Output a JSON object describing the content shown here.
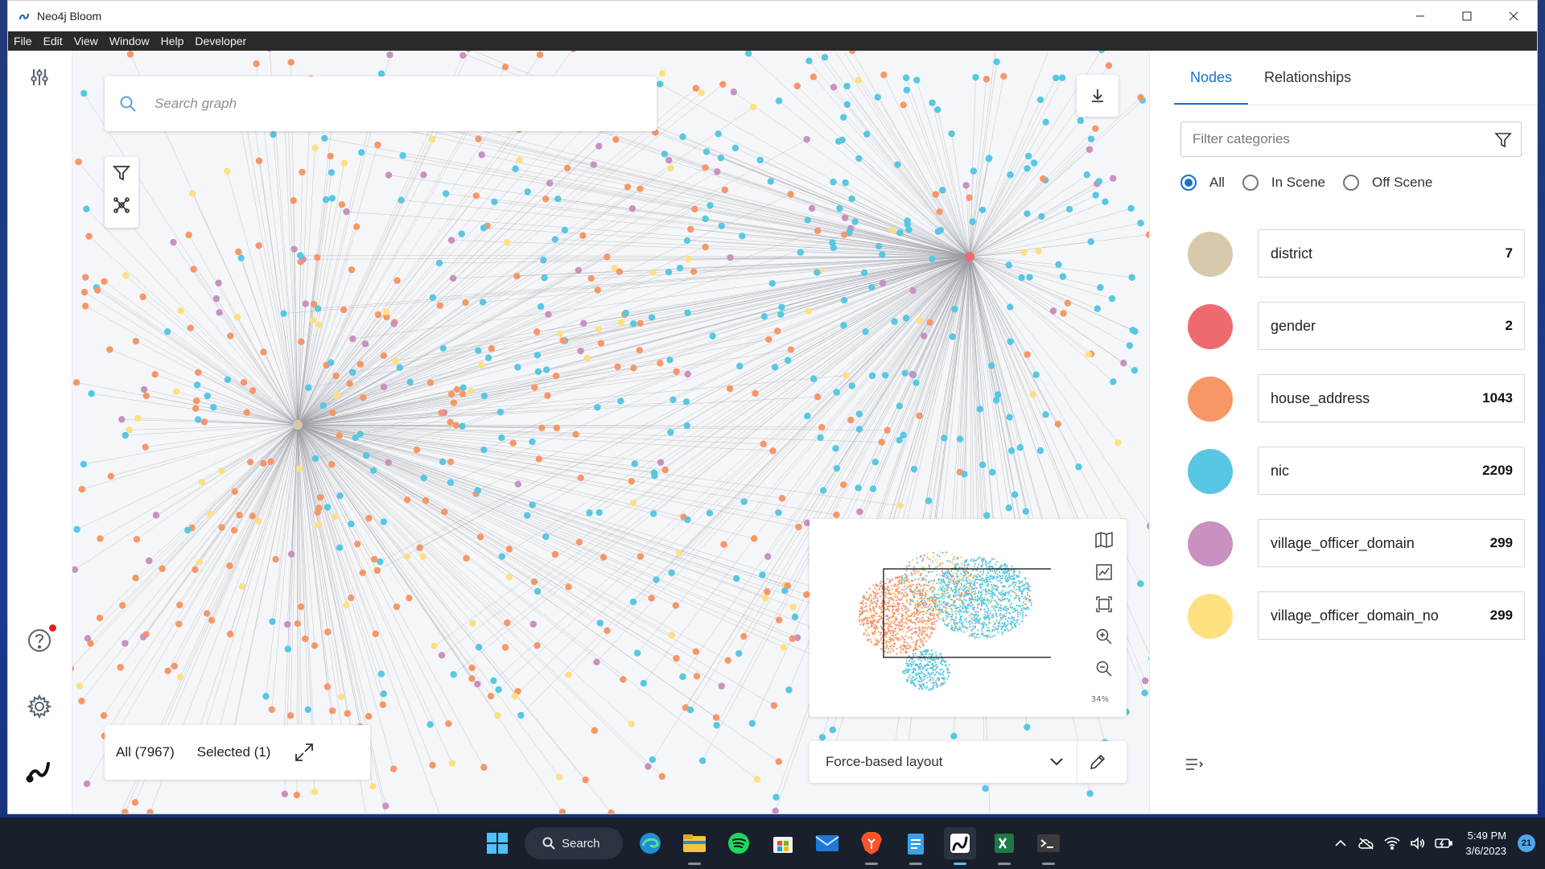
{
  "window": {
    "title": "Neo4j Bloom",
    "controls": [
      "minimize-icon",
      "maximize-icon",
      "close-icon"
    ]
  },
  "menu": [
    "File",
    "Edit",
    "View",
    "Window",
    "Help",
    "Developer"
  ],
  "left_rail": {
    "icons": [
      "sliders-icon",
      "help-icon",
      "gear-icon",
      "neo4j-logo-icon"
    ],
    "help_has_notification": true
  },
  "canvas": {
    "search_placeholder": "Search graph",
    "tools": [
      "filter-icon",
      "graph-algorithm-icon"
    ],
    "download_icon": "download-icon",
    "counts": {
      "all_label": "All (7967)",
      "selected_label": "Selected (1)"
    },
    "minimap": {
      "tools": [
        "map-icon",
        "chart-icon",
        "fit-screen-icon",
        "zoom-in-icon",
        "zoom-out-icon"
      ],
      "zoom_label": "34%"
    },
    "layout": {
      "selected": "Force-based layout"
    }
  },
  "right_panel": {
    "tabs": [
      {
        "label": "Nodes",
        "active": true
      },
      {
        "label": "Relationships",
        "active": false
      }
    ],
    "filter_placeholder": "Filter categories",
    "radios": [
      {
        "label": "All",
        "checked": true
      },
      {
        "label": "In Scene",
        "checked": false
      },
      {
        "label": "Off Scene",
        "checked": false
      }
    ],
    "categories": [
      {
        "name": "district",
        "count": "7",
        "color": "#d8c9ad"
      },
      {
        "name": "gender",
        "count": "2",
        "color": "#ef6a6f"
      },
      {
        "name": "house_address",
        "count": "1043",
        "color": "#f79767"
      },
      {
        "name": "nic",
        "count": "2209",
        "color": "#57c7e3"
      },
      {
        "name": "village_officer_domain",
        "count": "299",
        "color": "#c990c0"
      },
      {
        "name": "village_officer_domain_no",
        "count": "299",
        "color": "#ffe081"
      }
    ]
  },
  "taskbar": {
    "search_label": "Search",
    "apps": [
      "windows-start-icon",
      "edge-icon",
      "file-explorer-icon",
      "spotify-icon",
      "store-icon",
      "mail-icon",
      "brave-icon",
      "notepad-icon",
      "neo4j-bloom-icon",
      "excel-icon",
      "terminal-icon"
    ],
    "clock_time": "5:49 PM",
    "clock_date": "3/6/2023",
    "notification_count": "21"
  },
  "colors": {
    "accent": "#1a73c9",
    "district": "#d8c9ad",
    "gender": "#ef6a6f",
    "house_address": "#f79767",
    "nic": "#57c7e3",
    "village_officer_domain": "#c990c0",
    "village_officer_domain_no": "#ffe081"
  }
}
